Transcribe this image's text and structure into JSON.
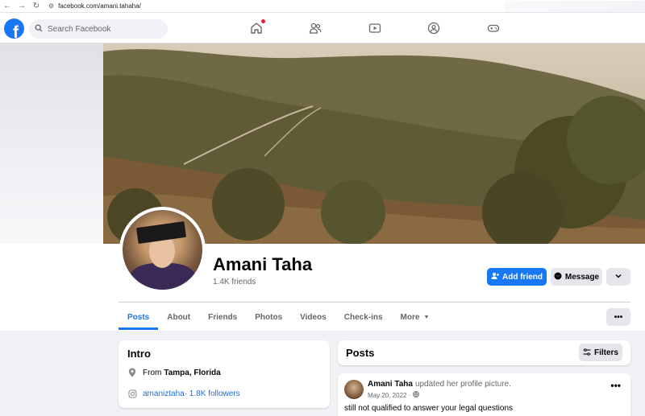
{
  "browser": {
    "url": "facebook.com/amani.tahaha/"
  },
  "topbar": {
    "logo": "f",
    "search_placeholder": "Search Facebook",
    "nav_icons": [
      "home-icon",
      "friends-icon",
      "video-icon",
      "groups-icon",
      "gaming-icon"
    ]
  },
  "profile": {
    "name": "Amani Taha",
    "friends": "1.4K friends",
    "add_friend_label": "Add friend",
    "message_label": "Message",
    "more_label": "⌄"
  },
  "tabs": [
    {
      "label": "Posts",
      "active": true
    },
    {
      "label": "About"
    },
    {
      "label": "Friends"
    },
    {
      "label": "Photos"
    },
    {
      "label": "Videos"
    },
    {
      "label": "Check-ins"
    },
    {
      "label": "More"
    }
  ],
  "tabs_more_label": "•••",
  "intro": {
    "title": "Intro",
    "location_prefix": "From",
    "location": "Tampa, Florida",
    "instagram": "amaniztaha",
    "instagram_followers": " · 1.8K followers"
  },
  "posts": {
    "title": "Posts",
    "filters_label": "Filters",
    "items": [
      {
        "author": "Amani Taha",
        "action": "updated her profile picture.",
        "date": "May 20, 2022 ·",
        "text": "still not qualified to answer your legal questions",
        "menu": "•••"
      }
    ]
  },
  "colors": {
    "brand": "#1877f2",
    "background": "#f0f2f5",
    "secondary_button": "#e4e6eb",
    "notification": "#e41e3f"
  }
}
